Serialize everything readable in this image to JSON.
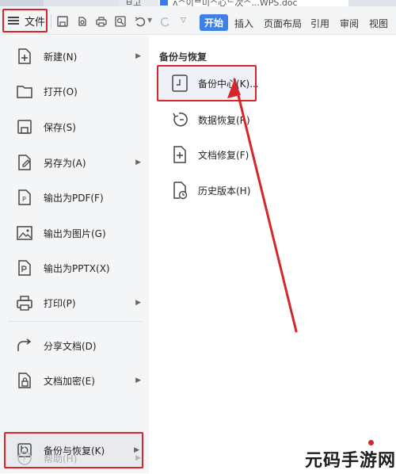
{
  "tabstrip": {
    "tab_doc_fragment": "ㅂ고",
    "tab_active_fragment": "ʌᄉ이ᄇ미ᄌ心ᄂ次ᄌ...WPS.doc"
  },
  "toolbar": {
    "file_label": "文件",
    "ribbon_tabs": [
      {
        "label": "开始",
        "active": true
      },
      {
        "label": "插入",
        "active": false
      },
      {
        "label": "页面布局",
        "active": false
      },
      {
        "label": "引用",
        "active": false
      },
      {
        "label": "审阅",
        "active": false
      },
      {
        "label": "视图",
        "active": false
      }
    ]
  },
  "left_menu": {
    "items": [
      {
        "label": "新建(N)",
        "icon": "new-file-icon",
        "has_submenu": true
      },
      {
        "label": "打开(O)",
        "icon": "folder-open-icon",
        "has_submenu": false
      },
      {
        "label": "保存(S)",
        "icon": "save-icon",
        "has_submenu": false
      },
      {
        "label": "另存为(A)",
        "icon": "save-as-icon",
        "has_submenu": true
      },
      {
        "label": "输出为PDF(F)",
        "icon": "export-pdf-icon",
        "has_submenu": false
      },
      {
        "label": "输出为图片(G)",
        "icon": "export-image-icon",
        "has_submenu": false
      },
      {
        "label": "输出为PPTX(X)",
        "icon": "export-pptx-icon",
        "has_submenu": false
      },
      {
        "label": "打印(P)",
        "icon": "print-icon",
        "has_submenu": true
      },
      {
        "label": "分享文档(D)",
        "icon": "share-icon",
        "has_submenu": false
      },
      {
        "label": "文档加密(E)",
        "icon": "encrypt-icon",
        "has_submenu": true
      },
      {
        "label": "备份与恢复(K)",
        "icon": "backup-icon",
        "has_submenu": true,
        "selected": true
      },
      {
        "label": "帮助(H)",
        "icon": "help-icon",
        "has_submenu": true,
        "disabled": true
      }
    ]
  },
  "right_panel": {
    "title": "备份与恢复",
    "items": [
      {
        "label": "备份中心(K)...",
        "icon": "backup-center-icon",
        "highlighted": true
      },
      {
        "label": "数据恢复(R)",
        "icon": "data-recovery-icon"
      },
      {
        "label": "文档修复(F)",
        "icon": "document-repair-icon"
      },
      {
        "label": "历史版本(H)",
        "icon": "history-version-icon"
      }
    ]
  },
  "watermark": {
    "text": "元码手游网"
  },
  "colors": {
    "highlight_border": "#d6262c",
    "active_tab": "#3f7fe8",
    "menu_bg": "#f4f5f7"
  }
}
